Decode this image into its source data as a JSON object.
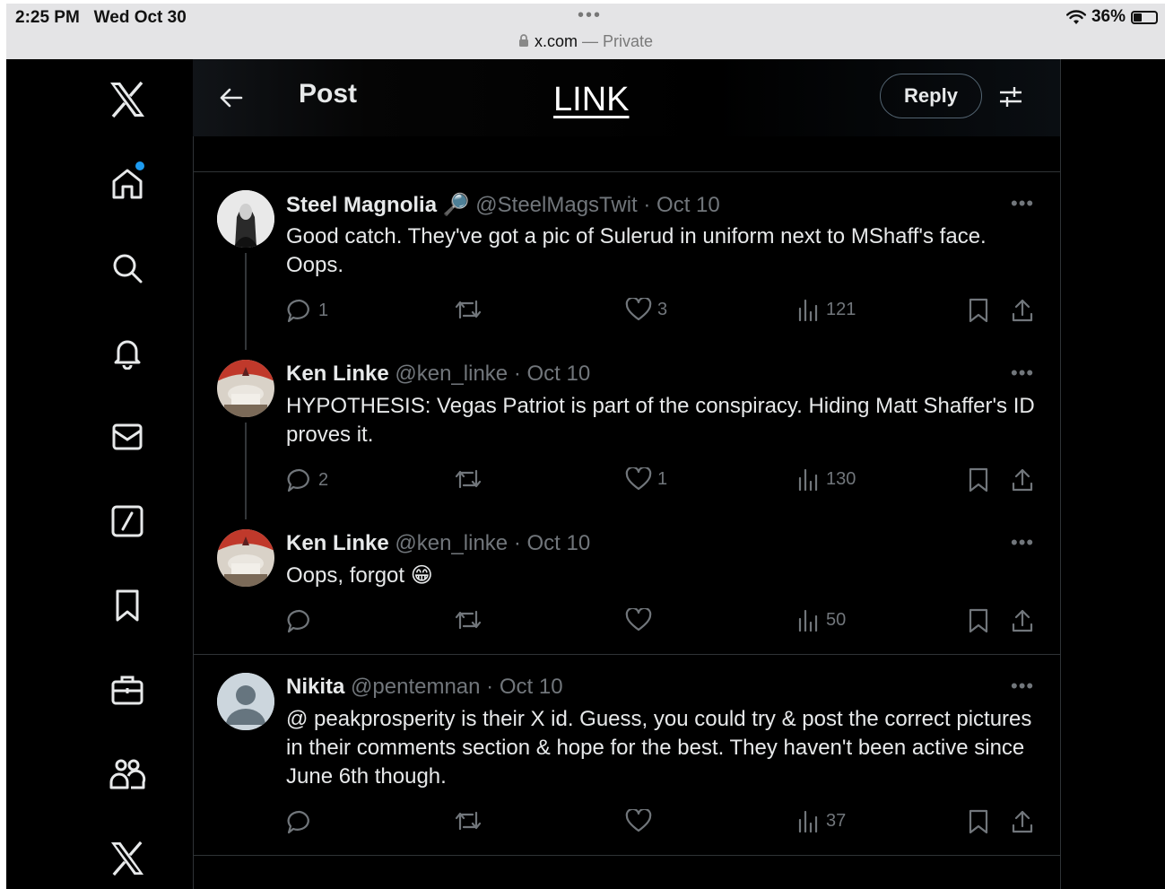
{
  "status_bar": {
    "time": "2:25 PM",
    "date": "Wed Oct 30",
    "battery": "36%",
    "battery_level": 0.36,
    "dots": "•••"
  },
  "browser": {
    "domain": "x.com",
    "separator": "—",
    "mode": "Private"
  },
  "sidebar": {
    "items": [
      "x-logo",
      "home",
      "search",
      "notifications",
      "messages",
      "grok",
      "bookmarks",
      "jobs",
      "communities",
      "premium"
    ]
  },
  "header": {
    "title": "Post",
    "overlay_text": "LINK",
    "reply_button": "Reply"
  },
  "tweets": [
    {
      "name": "Steel Magnolia",
      "name_emoji": "🔎",
      "handle": "@SteelMagsTwit",
      "dot": "·",
      "date": "Oct 10",
      "text": "Good catch. They've got a pic of Sulerud in uniform next to MShaff's face. Oops.",
      "replies": "1",
      "retweets": "",
      "likes": "3",
      "views": "121"
    },
    {
      "name": "Ken Linke",
      "handle": "@ken_linke",
      "dot": "·",
      "date": "Oct 10",
      "text": "HYPOTHESIS: Vegas Patriot is part of the conspiracy. Hiding Matt Shaffer's ID proves it.",
      "replies": "2",
      "retweets": "",
      "likes": "1",
      "views": "130"
    },
    {
      "name": "Ken Linke",
      "handle": "@ken_linke",
      "dot": "·",
      "date": "Oct 10",
      "text": "Oops, forgot",
      "text_emoji": "😁",
      "replies": "",
      "retweets": "",
      "likes": "",
      "views": "50"
    },
    {
      "name": "Nikita",
      "handle": "@pentemnan",
      "dot": "·",
      "date": "Oct 10",
      "text": "@ peakprosperity is their X id. Guess, you could try & post the correct pictures in their comments section & hope for the best. They haven't been active since June 6th though.",
      "replies": "",
      "retweets": "",
      "likes": "",
      "views": "37"
    }
  ],
  "colors": {
    "background": "#000000",
    "text_primary": "#e7e9ea",
    "text_secondary": "#71767b",
    "border": "#2f3336",
    "accent": "#1d9bf0"
  }
}
